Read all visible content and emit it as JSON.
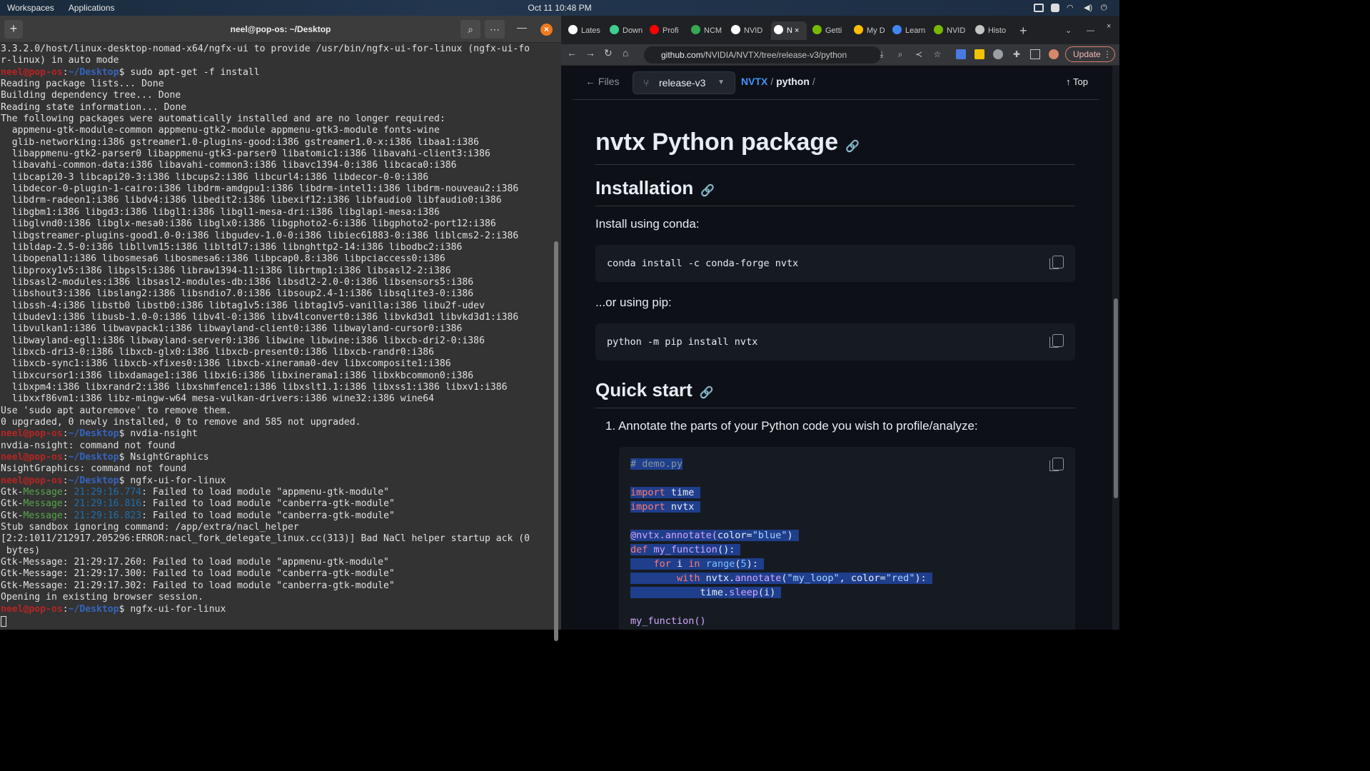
{
  "topbar": {
    "workspaces": "Workspaces",
    "applications": "Applications",
    "clock": "Oct 11  10:48 PM"
  },
  "terminal": {
    "title": "neel@pop-os: ~/Desktop",
    "new_tab": "+",
    "prompt_user": "neel@pop-os",
    "prompt_path": "~/Desktop",
    "lines": [
      {
        "t": "plain",
        "text": "3.3.2.0/host/linux-desktop-nomad-x64/ngfx-ui to provide /usr/bin/ngfx-ui-for-linux (ngfx-ui-fo"
      },
      {
        "t": "plain",
        "text": "r-linux) in auto mode"
      },
      {
        "t": "prompt",
        "text": "$ sudo apt-get -f install"
      },
      {
        "t": "plain",
        "text": "Reading package lists... Done"
      },
      {
        "t": "plain",
        "text": "Building dependency tree... Done"
      },
      {
        "t": "plain",
        "text": "Reading state information... Done"
      },
      {
        "t": "plain",
        "text": "The following packages were automatically installed and are no longer required:"
      },
      {
        "t": "plain",
        "text": "  appmenu-gtk-module-common appmenu-gtk2-module appmenu-gtk3-module fonts-wine"
      },
      {
        "t": "plain",
        "text": "  glib-networking:i386 gstreamer1.0-plugins-good:i386 gstreamer1.0-x:i386 libaa1:i386"
      },
      {
        "t": "plain",
        "text": "  libappmenu-gtk2-parser0 libappmenu-gtk3-parser0 libatomic1:i386 libavahi-client3:i386"
      },
      {
        "t": "plain",
        "text": "  libavahi-common-data:i386 libavahi-common3:i386 libavc1394-0:i386 libcaca0:i386"
      },
      {
        "t": "plain",
        "text": "  libcapi20-3 libcapi20-3:i386 libcups2:i386 libcurl4:i386 libdecor-0-0:i386"
      },
      {
        "t": "plain",
        "text": "  libdecor-0-plugin-1-cairo:i386 libdrm-amdgpu1:i386 libdrm-intel1:i386 libdrm-nouveau2:i386"
      },
      {
        "t": "plain",
        "text": "  libdrm-radeon1:i386 libdv4:i386 libedit2:i386 libexif12:i386 libfaudio0 libfaudio0:i386"
      },
      {
        "t": "plain",
        "text": "  libgbm1:i386 libgd3:i386 libgl1:i386 libgl1-mesa-dri:i386 libglapi-mesa:i386"
      },
      {
        "t": "plain",
        "text": "  libglvnd0:i386 libglx-mesa0:i386 libglx0:i386 libgphoto2-6:i386 libgphoto2-port12:i386"
      },
      {
        "t": "plain",
        "text": "  libgstreamer-plugins-good1.0-0:i386 libgudev-1.0-0:i386 libiec61883-0:i386 liblcms2-2:i386"
      },
      {
        "t": "plain",
        "text": "  libldap-2.5-0:i386 libllvm15:i386 libltdl7:i386 libnghttp2-14:i386 libodbc2:i386"
      },
      {
        "t": "plain",
        "text": "  libopenal1:i386 libosmesa6 libosmesa6:i386 libpcap0.8:i386 libpciaccess0:i386"
      },
      {
        "t": "plain",
        "text": "  libproxy1v5:i386 libpsl5:i386 libraw1394-11:i386 librtmp1:i386 libsasl2-2:i386"
      },
      {
        "t": "plain",
        "text": "  libsasl2-modules:i386 libsasl2-modules-db:i386 libsdl2-2.0-0:i386 libsensors5:i386"
      },
      {
        "t": "plain",
        "text": "  libshout3:i386 libslang2:i386 libsndio7.0:i386 libsoup2.4-1:i386 libsqlite3-0:i386"
      },
      {
        "t": "plain",
        "text": "  libssh-4:i386 libstb0 libstb0:i386 libtag1v5:i386 libtag1v5-vanilla:i386 libu2f-udev"
      },
      {
        "t": "plain",
        "text": "  libudev1:i386 libusb-1.0-0:i386 libv4l-0:i386 libv4lconvert0:i386 libvkd3d1 libvkd3d1:i386"
      },
      {
        "t": "plain",
        "text": "  libvulkan1:i386 libwavpack1:i386 libwayland-client0:i386 libwayland-cursor0:i386"
      },
      {
        "t": "plain",
        "text": "  libwayland-egl1:i386 libwayland-server0:i386 libwine libwine:i386 libxcb-dri2-0:i386"
      },
      {
        "t": "plain",
        "text": "  libxcb-dri3-0:i386 libxcb-glx0:i386 libxcb-present0:i386 libxcb-randr0:i386"
      },
      {
        "t": "plain",
        "text": "  libxcb-sync1:i386 libxcb-xfixes0:i386 libxcb-xinerama0-dev libxcomposite1:i386"
      },
      {
        "t": "plain",
        "text": "  libxcursor1:i386 libxdamage1:i386 libxi6:i386 libxinerama1:i386 libxkbcommon0:i386"
      },
      {
        "t": "plain",
        "text": "  libxpm4:i386 libxrandr2:i386 libxshmfence1:i386 libxslt1.1:i386 libxss1:i386 libxv1:i386"
      },
      {
        "t": "plain",
        "text": "  libxxf86vm1:i386 libz-mingw-w64 mesa-vulkan-drivers:i386 wine32:i386 wine64"
      },
      {
        "t": "plain",
        "text": "Use 'sudo apt autoremove' to remove them."
      },
      {
        "t": "plain",
        "text": "0 upgraded, 0 newly installed, 0 to remove and 585 not upgraded."
      },
      {
        "t": "prompt",
        "text": "$ nvdia-nsight"
      },
      {
        "t": "plain",
        "text": "nvdia-nsight: command not found"
      },
      {
        "t": "prompt",
        "text": "$ NsightGraphics"
      },
      {
        "t": "plain",
        "text": "NsightGraphics: command not found"
      },
      {
        "t": "prompt",
        "text": "$ ngfx-ui-for-linux"
      },
      {
        "t": "gtk",
        "ts": "21:29:16.774",
        "text": ": Failed to load module \"appmenu-gtk-module\""
      },
      {
        "t": "gtk",
        "ts": "21:29:16.816",
        "text": ": Failed to load module \"canberra-gtk-module\""
      },
      {
        "t": "gtk",
        "ts": "21:29:16.823",
        "text": ": Failed to load module \"canberra-gtk-module\""
      },
      {
        "t": "plain",
        "text": "Stub sandbox ignoring command: /app/extra/nacl_helper"
      },
      {
        "t": "plain",
        "text": "[2:2:1011/212917.205296:ERROR:nacl_fork_delegate_linux.cc(313)] Bad NaCl helper startup ack (0"
      },
      {
        "t": "plain",
        "text": " bytes)"
      },
      {
        "t": "plain",
        "text": "Gtk-Message: 21:29:17.260: Failed to load module \"appmenu-gtk-module\""
      },
      {
        "t": "plain",
        "text": "Gtk-Message: 21:29:17.300: Failed to load module \"canberra-gtk-module\""
      },
      {
        "t": "plain",
        "text": "Gtk-Message: 21:29:17.302: Failed to load module \"canberra-gtk-module\""
      },
      {
        "t": "plain",
        "text": "Opening in existing browser session."
      },
      {
        "t": "prompt",
        "text": "$ ngfx-ui-for-linux"
      }
    ]
  },
  "browser": {
    "tabs": [
      "Lates",
      "Down",
      "Profi",
      "NCM",
      "NVID",
      "N",
      "Getti",
      "My D",
      "Learn",
      "NVID",
      "Histo"
    ],
    "url_host": "github.com",
    "url_path": "/NVIDIA/NVTX/tree/release-v3/python",
    "update_label": "Update",
    "filebar": {
      "files": "Files",
      "branch": "release-v3",
      "repo": "NVTX",
      "sep": "/",
      "current": "python",
      "top": "Top"
    },
    "article": {
      "title": "nvtx Python package",
      "h_install": "Installation",
      "conda_intro": "Install using conda:",
      "conda_cmd": "conda install -c conda-forge nvtx",
      "pip_intro": "...or using pip:",
      "pip_cmd": "python -m pip install nvtx",
      "h_quick": "Quick start",
      "step1": "1. Annotate the parts of your Python code you wish to profile/analyze:",
      "demo_comment": "# demo.py",
      "demo_import1_kw": "import",
      "demo_import1_mod": " time",
      "demo_import2_kw": "import",
      "demo_import2_mod": " nvtx",
      "demo_deco_fn": "@nvtx.annotate(",
      "demo_deco_arg": "color=",
      "demo_deco_str": "\"blue\"",
      "demo_deco_end": ")",
      "demo_def_kw": "def",
      "demo_def_fn": " my_function",
      "demo_def_end": "():",
      "demo_for_kw": "for",
      "demo_for_mid": " i ",
      "demo_for_in": "in",
      "demo_for_range": " range",
      "demo_for_open": "(",
      "demo_for_num": "5",
      "demo_for_end": "):",
      "demo_with_kw": "with",
      "demo_with_obj": " nvtx.",
      "demo_with_fn": "annotate",
      "demo_with_open": "(",
      "demo_with_str1": "\"my_loop\"",
      "demo_with_mid": ", color=",
      "demo_with_str2": "\"red\"",
      "demo_with_end": "):",
      "demo_sleep_obj": "time.",
      "demo_sleep_fn": "sleep",
      "demo_sleep_end": "(i)",
      "demo_call": "my_function()"
    }
  }
}
